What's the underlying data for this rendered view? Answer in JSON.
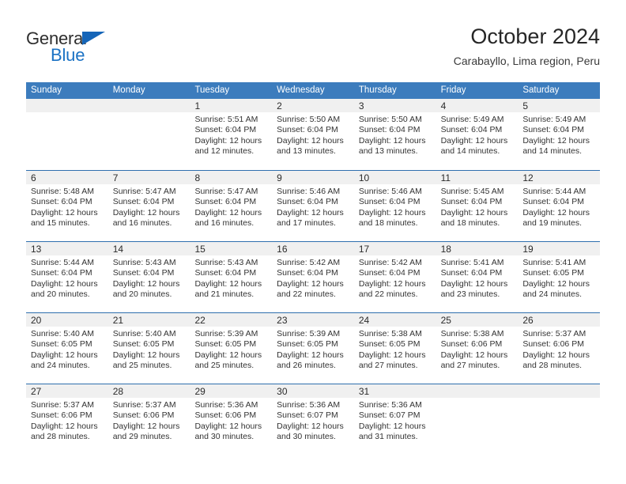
{
  "brand": {
    "name_top": "General",
    "name_bottom": "Blue",
    "triangle_color": "#1565b8",
    "blue_text_color": "#1b72c4"
  },
  "header": {
    "title": "October 2024",
    "subtitle": "Carabayllo, Lima region, Peru"
  },
  "calendar": {
    "header_bg": "#3c7cbd",
    "day_band_bg": "#f0f0f0",
    "weekdays": [
      "Sunday",
      "Monday",
      "Tuesday",
      "Wednesday",
      "Thursday",
      "Friday",
      "Saturday"
    ],
    "weeks": [
      [
        {
          "day": "",
          "lines": []
        },
        {
          "day": "",
          "lines": []
        },
        {
          "day": "1",
          "lines": [
            "Sunrise: 5:51 AM",
            "Sunset: 6:04 PM",
            "Daylight: 12 hours",
            "and 12 minutes."
          ]
        },
        {
          "day": "2",
          "lines": [
            "Sunrise: 5:50 AM",
            "Sunset: 6:04 PM",
            "Daylight: 12 hours",
            "and 13 minutes."
          ]
        },
        {
          "day": "3",
          "lines": [
            "Sunrise: 5:50 AM",
            "Sunset: 6:04 PM",
            "Daylight: 12 hours",
            "and 13 minutes."
          ]
        },
        {
          "day": "4",
          "lines": [
            "Sunrise: 5:49 AM",
            "Sunset: 6:04 PM",
            "Daylight: 12 hours",
            "and 14 minutes."
          ]
        },
        {
          "day": "5",
          "lines": [
            "Sunrise: 5:49 AM",
            "Sunset: 6:04 PM",
            "Daylight: 12 hours",
            "and 14 minutes."
          ]
        }
      ],
      [
        {
          "day": "6",
          "lines": [
            "Sunrise: 5:48 AM",
            "Sunset: 6:04 PM",
            "Daylight: 12 hours",
            "and 15 minutes."
          ]
        },
        {
          "day": "7",
          "lines": [
            "Sunrise: 5:47 AM",
            "Sunset: 6:04 PM",
            "Daylight: 12 hours",
            "and 16 minutes."
          ]
        },
        {
          "day": "8",
          "lines": [
            "Sunrise: 5:47 AM",
            "Sunset: 6:04 PM",
            "Daylight: 12 hours",
            "and 16 minutes."
          ]
        },
        {
          "day": "9",
          "lines": [
            "Sunrise: 5:46 AM",
            "Sunset: 6:04 PM",
            "Daylight: 12 hours",
            "and 17 minutes."
          ]
        },
        {
          "day": "10",
          "lines": [
            "Sunrise: 5:46 AM",
            "Sunset: 6:04 PM",
            "Daylight: 12 hours",
            "and 18 minutes."
          ]
        },
        {
          "day": "11",
          "lines": [
            "Sunrise: 5:45 AM",
            "Sunset: 6:04 PM",
            "Daylight: 12 hours",
            "and 18 minutes."
          ]
        },
        {
          "day": "12",
          "lines": [
            "Sunrise: 5:44 AM",
            "Sunset: 6:04 PM",
            "Daylight: 12 hours",
            "and 19 minutes."
          ]
        }
      ],
      [
        {
          "day": "13",
          "lines": [
            "Sunrise: 5:44 AM",
            "Sunset: 6:04 PM",
            "Daylight: 12 hours",
            "and 20 minutes."
          ]
        },
        {
          "day": "14",
          "lines": [
            "Sunrise: 5:43 AM",
            "Sunset: 6:04 PM",
            "Daylight: 12 hours",
            "and 20 minutes."
          ]
        },
        {
          "day": "15",
          "lines": [
            "Sunrise: 5:43 AM",
            "Sunset: 6:04 PM",
            "Daylight: 12 hours",
            "and 21 minutes."
          ]
        },
        {
          "day": "16",
          "lines": [
            "Sunrise: 5:42 AM",
            "Sunset: 6:04 PM",
            "Daylight: 12 hours",
            "and 22 minutes."
          ]
        },
        {
          "day": "17",
          "lines": [
            "Sunrise: 5:42 AM",
            "Sunset: 6:04 PM",
            "Daylight: 12 hours",
            "and 22 minutes."
          ]
        },
        {
          "day": "18",
          "lines": [
            "Sunrise: 5:41 AM",
            "Sunset: 6:04 PM",
            "Daylight: 12 hours",
            "and 23 minutes."
          ]
        },
        {
          "day": "19",
          "lines": [
            "Sunrise: 5:41 AM",
            "Sunset: 6:05 PM",
            "Daylight: 12 hours",
            "and 24 minutes."
          ]
        }
      ],
      [
        {
          "day": "20",
          "lines": [
            "Sunrise: 5:40 AM",
            "Sunset: 6:05 PM",
            "Daylight: 12 hours",
            "and 24 minutes."
          ]
        },
        {
          "day": "21",
          "lines": [
            "Sunrise: 5:40 AM",
            "Sunset: 6:05 PM",
            "Daylight: 12 hours",
            "and 25 minutes."
          ]
        },
        {
          "day": "22",
          "lines": [
            "Sunrise: 5:39 AM",
            "Sunset: 6:05 PM",
            "Daylight: 12 hours",
            "and 25 minutes."
          ]
        },
        {
          "day": "23",
          "lines": [
            "Sunrise: 5:39 AM",
            "Sunset: 6:05 PM",
            "Daylight: 12 hours",
            "and 26 minutes."
          ]
        },
        {
          "day": "24",
          "lines": [
            "Sunrise: 5:38 AM",
            "Sunset: 6:05 PM",
            "Daylight: 12 hours",
            "and 27 minutes."
          ]
        },
        {
          "day": "25",
          "lines": [
            "Sunrise: 5:38 AM",
            "Sunset: 6:06 PM",
            "Daylight: 12 hours",
            "and 27 minutes."
          ]
        },
        {
          "day": "26",
          "lines": [
            "Sunrise: 5:37 AM",
            "Sunset: 6:06 PM",
            "Daylight: 12 hours",
            "and 28 minutes."
          ]
        }
      ],
      [
        {
          "day": "27",
          "lines": [
            "Sunrise: 5:37 AM",
            "Sunset: 6:06 PM",
            "Daylight: 12 hours",
            "and 28 minutes."
          ]
        },
        {
          "day": "28",
          "lines": [
            "Sunrise: 5:37 AM",
            "Sunset: 6:06 PM",
            "Daylight: 12 hours",
            "and 29 minutes."
          ]
        },
        {
          "day": "29",
          "lines": [
            "Sunrise: 5:36 AM",
            "Sunset: 6:06 PM",
            "Daylight: 12 hours",
            "and 30 minutes."
          ]
        },
        {
          "day": "30",
          "lines": [
            "Sunrise: 5:36 AM",
            "Sunset: 6:07 PM",
            "Daylight: 12 hours",
            "and 30 minutes."
          ]
        },
        {
          "day": "31",
          "lines": [
            "Sunrise: 5:36 AM",
            "Sunset: 6:07 PM",
            "Daylight: 12 hours",
            "and 31 minutes."
          ]
        },
        {
          "day": "",
          "lines": []
        },
        {
          "day": "",
          "lines": []
        }
      ]
    ]
  }
}
